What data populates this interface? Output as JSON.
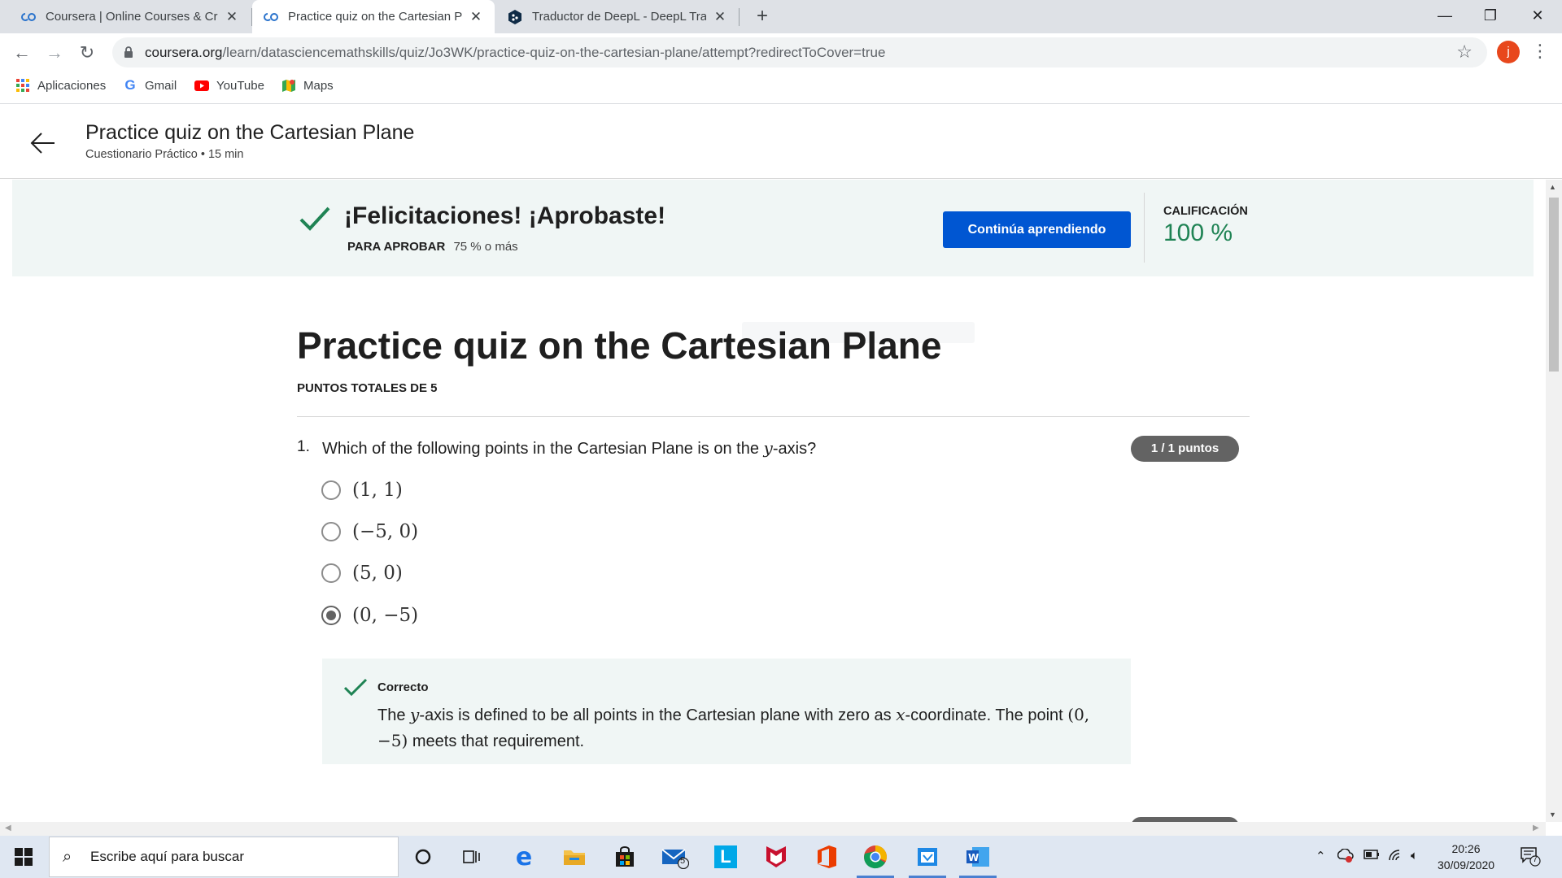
{
  "browser": {
    "tabs": [
      {
        "title": "Coursera | Online Courses & Credentials",
        "active": false
      },
      {
        "title": "Practice quiz on the Cartesian Plane",
        "active": true
      },
      {
        "title": "Traductor de DeepL - DeepL Translate",
        "active": false
      }
    ],
    "url_host": "coursera.org",
    "url_path": "/learn/datasciencemathskills/quiz/Jo3WK/practice-quiz-on-the-cartesian-plane/attempt?redirectToCover=true",
    "profile_initial": "j",
    "bookmarks": [
      {
        "label": "Aplicaciones",
        "icon": "apps-grid-icon"
      },
      {
        "label": "Gmail",
        "icon": "google-icon"
      },
      {
        "label": "YouTube",
        "icon": "youtube-icon"
      },
      {
        "label": "Maps",
        "icon": "maps-icon"
      }
    ]
  },
  "header": {
    "title": "Practice quiz on the Cartesian Plane",
    "subtitle": "Cuestionario Práctico • 15 min"
  },
  "result": {
    "congrats": "¡Felicitaciones! ¡Aprobaste!",
    "pass_label": "PARA APROBAR",
    "pass_value": "75 % o más",
    "continue_label": "Continúa aprendiendo",
    "grade_label": "CALIFICACIÓN",
    "grade_value": "100 %",
    "accent": "#1f8354",
    "button_color": "#0056d2"
  },
  "quiz": {
    "title": "Practice quiz on the Cartesian Plane",
    "total_points": "PUNTOS TOTALES DE 5",
    "questions": [
      {
        "number": "1.",
        "text_before": "Which of the following points in the Cartesian Plane is on the ",
        "text_math": "y",
        "text_after": "-axis?",
        "score": "1 / 1 puntos",
        "options": [
          {
            "label": "(1, 1)",
            "selected": false
          },
          {
            "label": "(−5, 0)",
            "selected": false
          },
          {
            "label": "(5, 0)",
            "selected": false
          },
          {
            "label": "(0, −5)",
            "selected": true
          }
        ],
        "feedback": {
          "title": "Correcto",
          "part1": "The ",
          "math1": "y",
          "part2": "-axis is defined to be all points in the Cartesian plane with zero as ",
          "math2": "x",
          "part3": "-coordinate. The point ",
          "math3": "(0, −5)",
          "part4": " meets that requirement."
        }
      }
    ]
  },
  "taskbar": {
    "search_placeholder": "Escribe aquí para buscar",
    "mail_badge": "5",
    "time": "20:26",
    "date": "30/09/2020",
    "notifications": "7"
  }
}
